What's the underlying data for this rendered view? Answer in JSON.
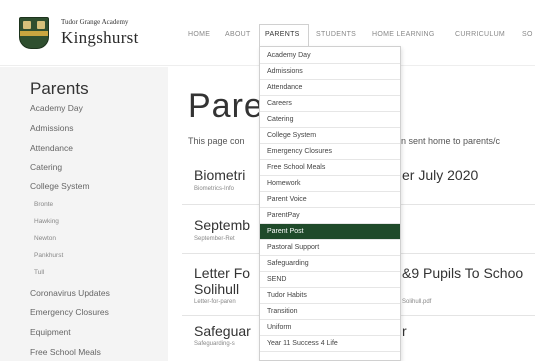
{
  "header": {
    "school_name_small": "Tudor Grange Academy",
    "school_name_big": "Kingshurst",
    "logo_icon": "crest-logo"
  },
  "nav": {
    "items": [
      "HOME",
      "ABOUT",
      "PARENTS",
      "STUDENTS",
      "HOME LEARNING",
      "CURRICULUM",
      "SO"
    ],
    "active": "PARENTS"
  },
  "sidebar": {
    "title": "Parents",
    "items": [
      "Academy Day",
      "Admissions",
      "Attendance",
      "Catering",
      "College System",
      "Coronavirus Updates",
      "Emergency Closures",
      "Equipment",
      "Free School Meals"
    ],
    "college_sub_items": [
      "Bronte",
      "Hawking",
      "Newton",
      "Pankhurst",
      "Tull"
    ]
  },
  "main": {
    "title": "Pare",
    "intro_left": "This page con",
    "intro_right": "n sent home to parents/c",
    "cards": [
      {
        "title_left": "Biometri",
        "title_right": "er July 2020",
        "sub_left": "Biometrics-Info",
        "sub_right": ""
      },
      {
        "title_left": "Septemb",
        "title_right": "",
        "sub_left": "September-Ret",
        "sub_right": ""
      },
      {
        "title_left": "Letter Fo",
        "title_line2": "Solihull",
        "title_right": "&9 Pupils To Schoo",
        "sub_left": "Letter-for-paren",
        "sub_right": "Solihull.pdf"
      },
      {
        "title_left": "Safeguar",
        "title_right": "r",
        "sub_left": "Safeguarding-s",
        "sub_right": ""
      }
    ]
  },
  "dropdown": {
    "items": [
      "Academy Day",
      "Admissions",
      "Attendance",
      "Careers",
      "Catering",
      "College System",
      "Emergency Closures",
      "Free School Meals",
      "Homework",
      "Parent Voice",
      "ParentPay",
      "Parent Post",
      "Pastoral Support",
      "Safeguarding",
      "SEND",
      "Tudor Habits",
      "Transition",
      "Uniform",
      "Year 11 Success 4 Life"
    ],
    "highlighted": "Parent Post",
    "highlight_color": "#1f4a2a"
  }
}
